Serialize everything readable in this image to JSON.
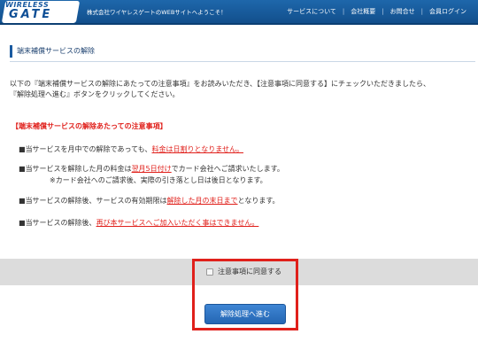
{
  "header": {
    "logo_top": "WIRELESS",
    "logo_bottom": "GATE",
    "tagline": "株式会社ワイヤレスゲートのWEBサイトへようこそ！",
    "nav": [
      "サービスについて",
      "会社概要",
      "お問合せ",
      "会員ログイン"
    ]
  },
  "section": {
    "title": "端末補償サービスの解除"
  },
  "intro": {
    "line1": "以下の『端末補償サービスの解除にあたっての注意事項』をお読みいただき、【注意事項に同意する】にチェックいただきましたら、",
    "line2": "『解除処理へ進む』ボタンをクリックしてください。"
  },
  "notice": {
    "heading": "【端末補償サービスの解除あたっての注意事項】",
    "bullet": "■",
    "item1_prefix": "当サービスを月中での解除であっても、",
    "item1_red": "料金は日割りとなりません。",
    "item2_prefix": "当サービスを解除した月の料金は",
    "item2_red": "翌月5日付け",
    "item2_suffix": "でカード会社へご請求いたします。",
    "item2_note": "※カード会社へのご請求後、実際の引き落とし日は後日となります。",
    "item3_prefix": "当サービスの解除後、サービスの有効期限は",
    "item3_red": "解除した月の末日まで",
    "item3_suffix": "となります。",
    "item4_prefix": "当サービスの解除後、",
    "item4_red": "再び本サービスへご加入いただく事はできません。"
  },
  "consent": {
    "checkbox_label": "注意事項に同意する",
    "checked": false
  },
  "proceed_button": {
    "label": "解除処理へ進む"
  },
  "colors": {
    "brand_blue": "#1a5aa0",
    "alert_red": "#e0201b",
    "band_gray": "#dcdcdc"
  }
}
